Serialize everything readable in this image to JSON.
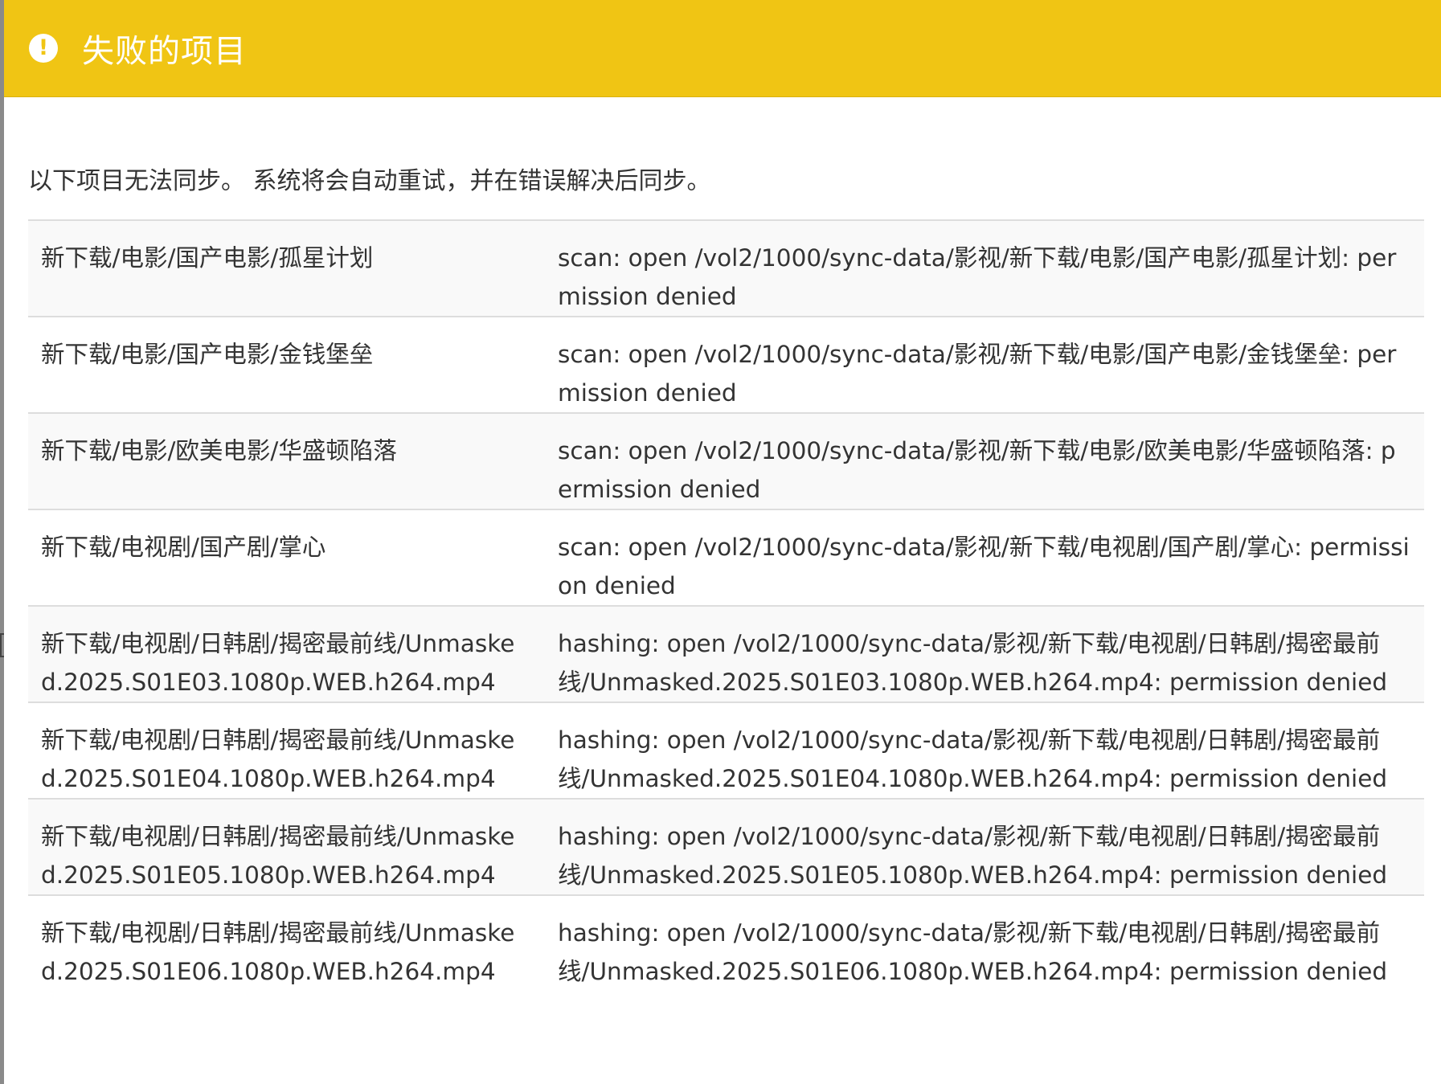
{
  "dialog": {
    "title": "失败的项目",
    "icon": "exclamation-circle-icon",
    "accent_color": "#f0c514",
    "intro": "以下项目无法同步。 系统将会自动重试，并在错误解决后同步。"
  },
  "failures": [
    {
      "path": "新下载/电影/国产电影/孤星计划",
      "error": "scan: open /vol2/1000/sync-data/影视/新下载/电影/国产电影/孤星计划: permission denied"
    },
    {
      "path": "新下载/电影/国产电影/金钱堡垒",
      "error": "scan: open /vol2/1000/sync-data/影视/新下载/电影/国产电影/金钱堡垒: permission denied"
    },
    {
      "path": "新下载/电影/欧美电影/华盛顿陷落",
      "error": "scan: open /vol2/1000/sync-data/影视/新下载/电影/欧美电影/华盛顿陷落: permission denied"
    },
    {
      "path": "新下载/电视剧/国产剧/掌心",
      "error": "scan: open /vol2/1000/sync-data/影视/新下载/电视剧/国产剧/掌心: permission denied"
    },
    {
      "path": "新下载/电视剧/日韩剧/揭密最前线/Unmasked.2025.S01E03.1080p.WEB.h264.mp4",
      "error": "hashing: open /vol2/1000/sync-data/影视/新下载/电视剧/日韩剧/揭密最前线/Unmasked.2025.S01E03.1080p.WEB.h264.mp4: permission denied"
    },
    {
      "path": "新下载/电视剧/日韩剧/揭密最前线/Unmasked.2025.S01E04.1080p.WEB.h264.mp4",
      "error": "hashing: open /vol2/1000/sync-data/影视/新下载/电视剧/日韩剧/揭密最前线/Unmasked.2025.S01E04.1080p.WEB.h264.mp4: permission denied"
    },
    {
      "path": "新下载/电视剧/日韩剧/揭密最前线/Unmasked.2025.S01E05.1080p.WEB.h264.mp4",
      "error": "hashing: open /vol2/1000/sync-data/影视/新下载/电视剧/日韩剧/揭密最前线/Unmasked.2025.S01E05.1080p.WEB.h264.mp4: permission denied"
    },
    {
      "path": "新下载/电视剧/日韩剧/揭密最前线/Unmasked.2025.S01E06.1080p.WEB.h264.mp4",
      "error": "hashing: open /vol2/1000/sync-data/影视/新下载/电视剧/日韩剧/揭密最前线/Unmasked.2025.S01E06.1080p.WEB.h264.mp4: permission denied"
    }
  ]
}
